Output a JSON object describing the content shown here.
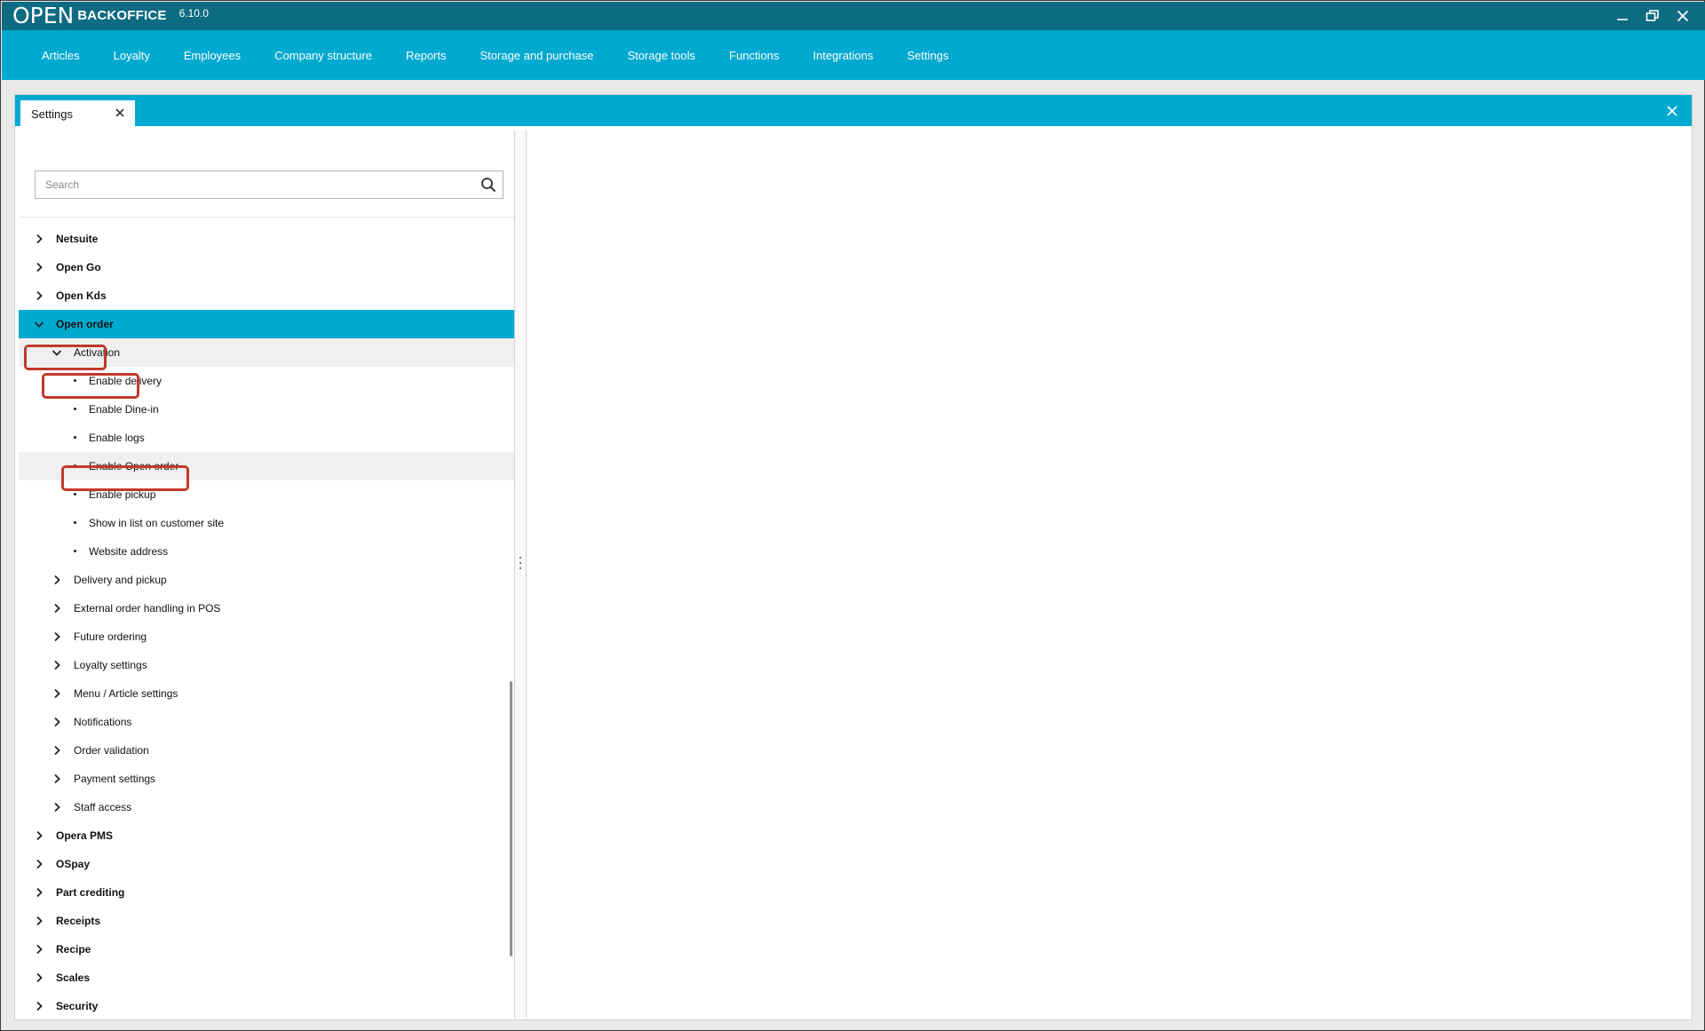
{
  "app": {
    "logo": "OPEN",
    "name": "BACKOFFICE",
    "version": "6.10.0"
  },
  "window_controls": [
    "minimize-icon",
    "restore-icon",
    "close-icon"
  ],
  "menu": [
    "Articles",
    "Loyalty",
    "Employees",
    "Company structure",
    "Reports",
    "Storage and purchase",
    "Storage tools",
    "Functions",
    "Integrations",
    "Settings"
  ],
  "tab": {
    "label": "Settings"
  },
  "search": {
    "placeholder": "Search",
    "value": ""
  },
  "tree": [
    {
      "label": "Netsuite",
      "level": 1,
      "expanded": false
    },
    {
      "label": "Open Go",
      "level": 1,
      "expanded": false
    },
    {
      "label": "Open Kds",
      "level": 1,
      "expanded": false
    },
    {
      "label": "Open order",
      "level": 1,
      "expanded": true,
      "selected": true,
      "highlighted": true
    },
    {
      "label": "Activation",
      "level": 2,
      "expanded": true,
      "highlighted": true
    },
    {
      "label": "Enable delivery",
      "level": 3
    },
    {
      "label": "Enable Dine-in",
      "level": 3
    },
    {
      "label": "Enable logs",
      "level": 3
    },
    {
      "label": "Enable Open order",
      "level": 3,
      "highlighted": true
    },
    {
      "label": "Enable pickup",
      "level": 3
    },
    {
      "label": "Show in list on customer site",
      "level": 3
    },
    {
      "label": "Website address",
      "level": 3
    },
    {
      "label": "Delivery and pickup",
      "level": 2,
      "expanded": false
    },
    {
      "label": "External order handling in POS",
      "level": 2,
      "expanded": false
    },
    {
      "label": "Future ordering",
      "level": 2,
      "expanded": false
    },
    {
      "label": "Loyalty settings",
      "level": 2,
      "expanded": false
    },
    {
      "label": "Menu / Article settings",
      "level": 2,
      "expanded": false
    },
    {
      "label": "Notifications",
      "level": 2,
      "expanded": false
    },
    {
      "label": "Order validation",
      "level": 2,
      "expanded": false
    },
    {
      "label": "Payment settings",
      "level": 2,
      "expanded": false
    },
    {
      "label": "Staff access",
      "level": 2,
      "expanded": false
    },
    {
      "label": "Opera PMS",
      "level": 1,
      "expanded": false
    },
    {
      "label": "OSpay",
      "level": 1,
      "expanded": false
    },
    {
      "label": "Part crediting",
      "level": 1,
      "expanded": false
    },
    {
      "label": "Receipts",
      "level": 1,
      "expanded": false
    },
    {
      "label": "Recipe",
      "level": 1,
      "expanded": false
    },
    {
      "label": "Scales",
      "level": 1,
      "expanded": false
    },
    {
      "label": "Security",
      "level": 1,
      "expanded": false
    }
  ],
  "colors": {
    "titlebar": "#0d6b82",
    "accent": "#00a9cf",
    "highlight_box": "#c0392b",
    "row_hover": "#f0f0f0"
  }
}
